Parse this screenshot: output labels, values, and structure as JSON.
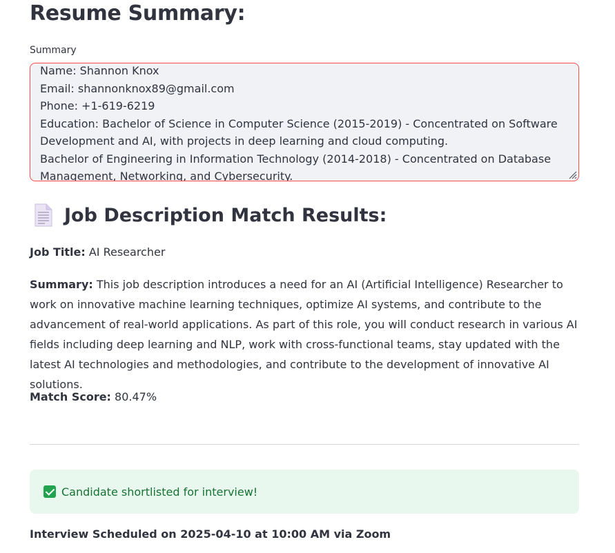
{
  "resume_section": {
    "heading": "Resume Summary:",
    "summary_label": "Summary",
    "summary_text": "Name: Shannon Knox\nEmail: shannonknox89@gmail.com\nPhone: +1-619-6219\nEducation: Bachelor of Science in Computer Science (2015-2019) - Concentrated on Software Development and AI, with projects in deep learning and cloud computing.\nBachelor of Engineering in Information Technology (2014-2018) - Concentrated on Database Management, Networking, and Cybersecurity."
  },
  "match_results": {
    "icon": "document-icon",
    "heading": "Job Description Match Results:",
    "job_title_label": "Job Title:",
    "job_title_value": "AI Researcher",
    "summary_label": "Summary:",
    "summary_value": "This job description introduces a need for an AI (Artificial Intelligence) Researcher to work on innovative machine learning techniques, optimize AI systems, and contribute to the advancement of real-world applications. As part of this role, you will conduct research in various AI fields including deep learning and NLP, work with cross-functional teams, stay updated with the latest AI technologies and methodologies, and contribute to the development of innovative AI solutions.",
    "match_score_label": "Match Score:",
    "match_score_value": "80.47%"
  },
  "status": {
    "icon": "check-mark-icon",
    "message": "Candidate shortlisted for interview!"
  },
  "interview": {
    "text": "Interview Scheduled on 2025-04-10 at 10:00 AM via Zoom"
  },
  "colors": {
    "text": "#31333f",
    "textarea_border": "#ff4b4b",
    "textarea_bg": "#f0f2f6",
    "success_bg": "#e9f8ee",
    "success_text": "#177233"
  }
}
